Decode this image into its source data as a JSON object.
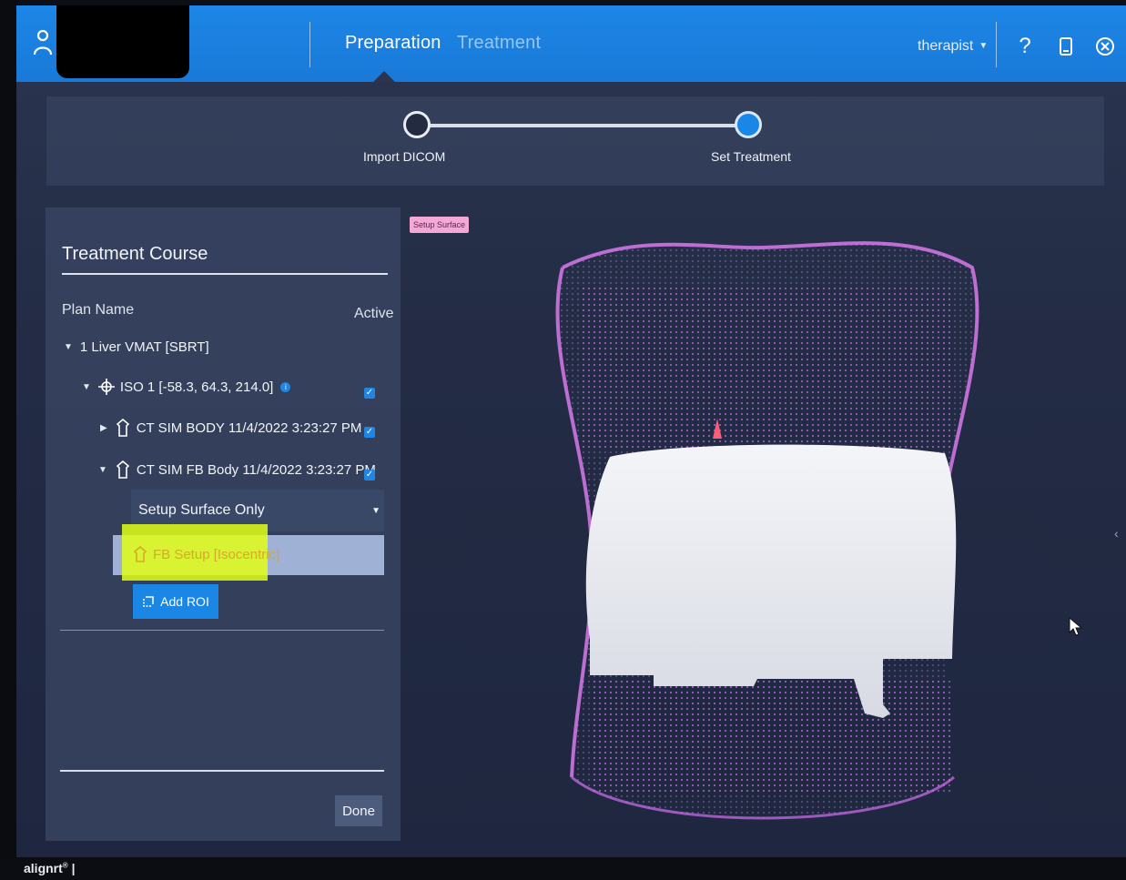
{
  "header": {
    "tabs": [
      {
        "label": "Preparation",
        "active": true
      },
      {
        "label": "Treatment",
        "active": false
      }
    ],
    "user": "therapist",
    "icons": [
      "user-icon",
      "help-icon",
      "tablet-icon",
      "close-icon"
    ],
    "accent_color": "#1a86e6"
  },
  "stepper": {
    "steps": [
      {
        "label": "Import DICOM",
        "state": "done"
      },
      {
        "label": "Set Treatment",
        "state": "current"
      }
    ]
  },
  "treatment_course": {
    "title": "Treatment Course",
    "col_plan": "Plan Name",
    "col_active": "Active",
    "plan": "1 Liver VMAT [SBRT]",
    "iso": "ISO 1 [-58.3, 64.3, 214.0]",
    "ct1": "CT SIM BODY 11/4/2022 3:23:27 PM",
    "ct2": "CT SIM FB Body 11/4/2022 3:23:27 PM",
    "dropdown_value": "Setup Surface Only",
    "selected_roi": "FB Setup [Isocentric]",
    "add_roi": "Add ROI",
    "done": "Done",
    "active_checked": [
      true,
      true,
      true
    ]
  },
  "viewer": {
    "tag": "Setup Surface"
  },
  "footer": {
    "brand": "alignrt"
  }
}
